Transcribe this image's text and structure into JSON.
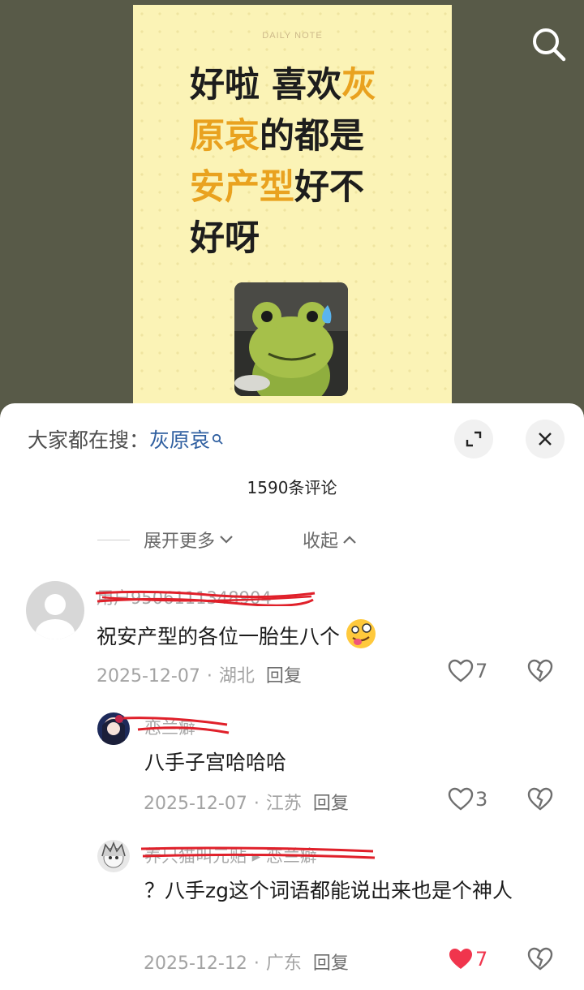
{
  "post": {
    "daily_note": "DAILY NOTE",
    "headline_lines": [
      [
        {
          "t": "好啦 喜欢",
          "h": false
        },
        {
          "t": "灰",
          "h": true
        }
      ],
      [
        {
          "t": "原哀",
          "h": true
        },
        {
          "t": "的都是",
          "h": false
        }
      ],
      [
        {
          "t": "安产型",
          "h": true
        },
        {
          "t": "好不",
          "h": false
        }
      ],
      [
        {
          "t": "好呀",
          "h": false
        }
      ]
    ]
  },
  "sheet": {
    "search_prefix": "大家都在搜：",
    "search_term": "灰原哀",
    "comment_count": "1590条评论",
    "expand_more": "展开更多",
    "collapse": "收起"
  },
  "comments": [
    {
      "username": "用户9506111348904",
      "text": "祝安产型的各位一胎生八个",
      "date": "2025-12-07",
      "location": "湖北",
      "reply": "回复",
      "likes": "7",
      "liked": false
    },
    {
      "username": "恋兰癖",
      "text": "八手子宫哈哈哈",
      "date": "2025-12-07",
      "location": "江苏",
      "reply": "回复",
      "likes": "3",
      "liked": false
    },
    {
      "username": "养只猫叫元贴 ▸ 恋兰癖",
      "text": "？八手zg这个词语都能说出来也是个神人",
      "date": "2025-12-12",
      "location": "广东",
      "reply": "回复",
      "likes": "7",
      "liked": true
    }
  ],
  "colors": {
    "accent_orange": "#e9a21f",
    "link_blue": "#2f5fa0",
    "like_red": "#f0354d",
    "scribble_red": "#e0202a"
  }
}
